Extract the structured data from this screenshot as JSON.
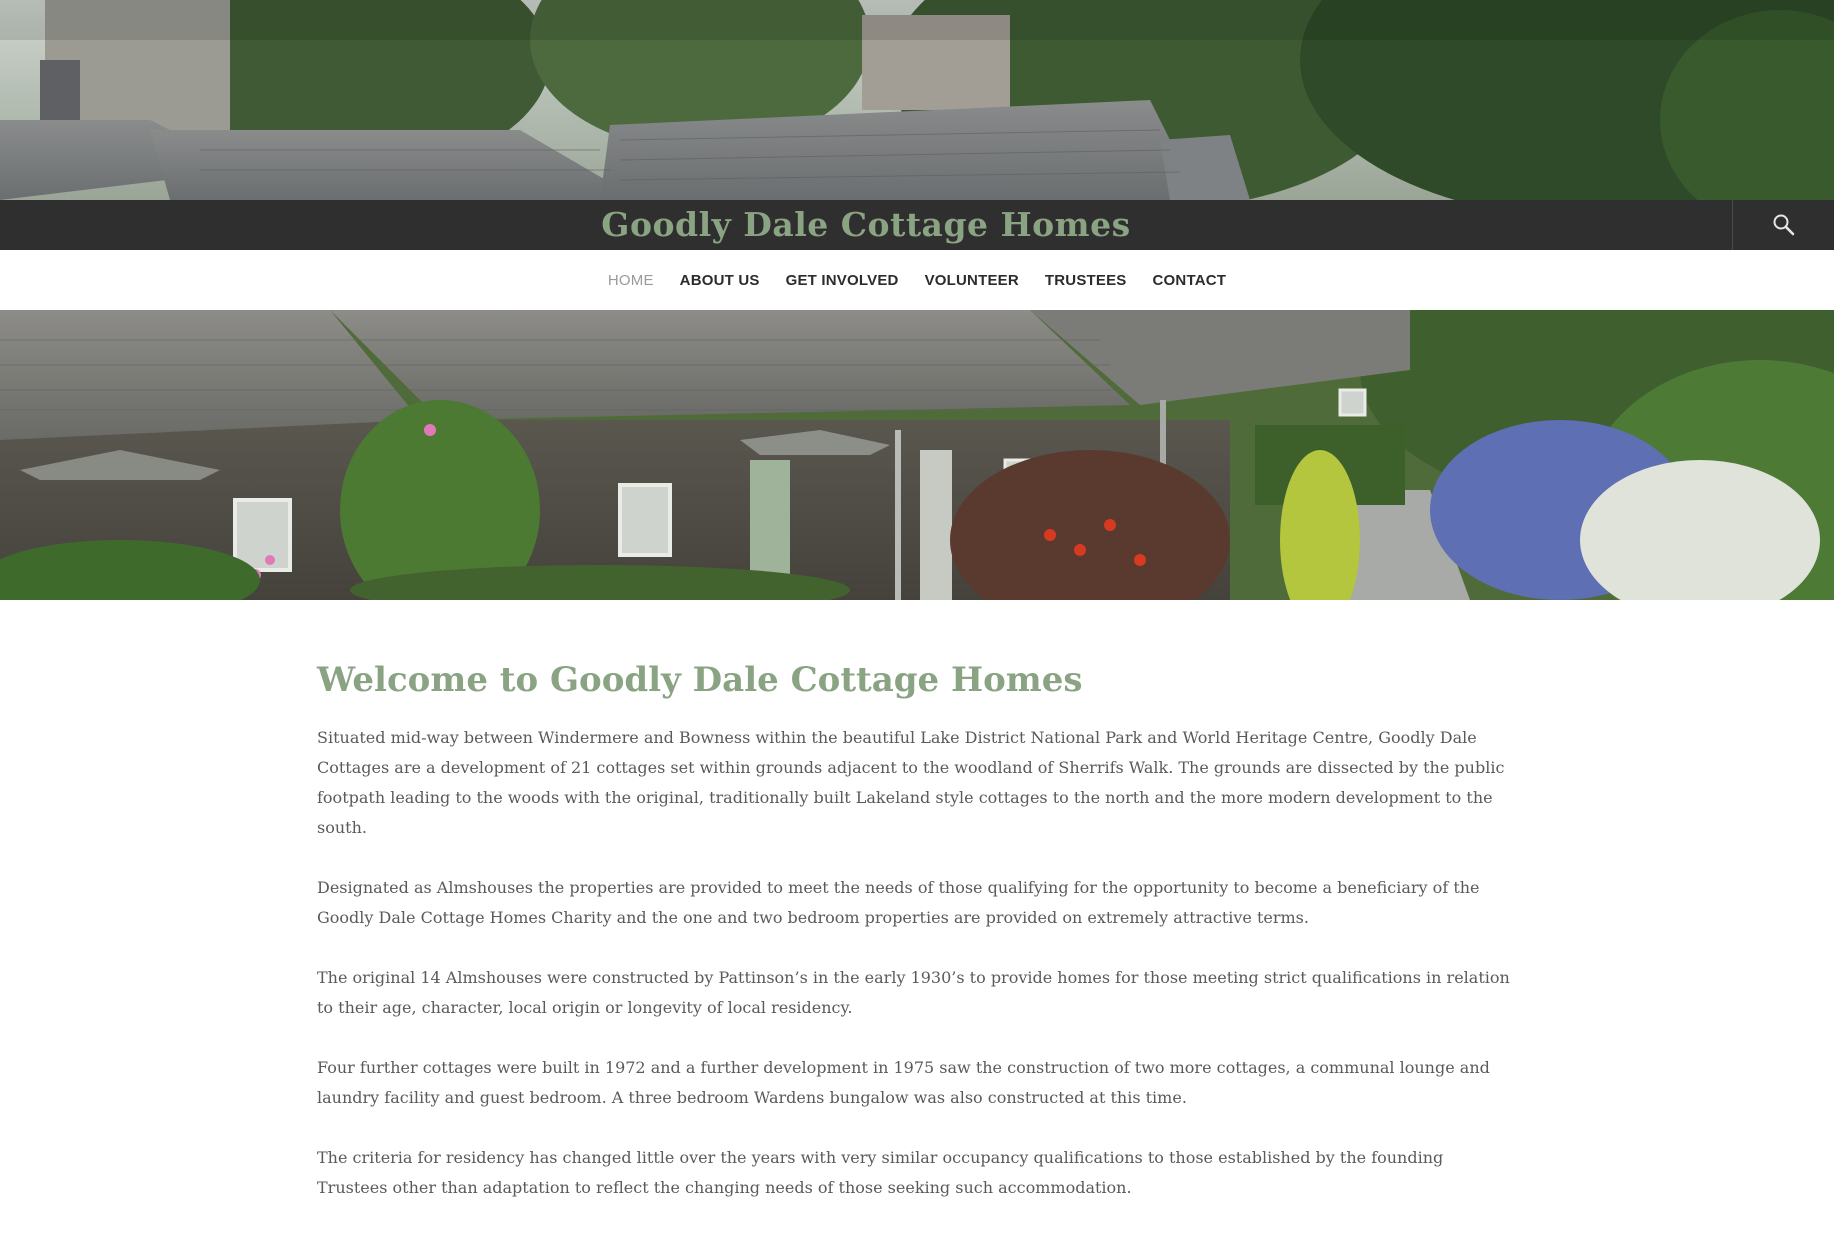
{
  "site": {
    "title": "Goodly Dale Cottage Homes"
  },
  "nav": {
    "items": [
      {
        "label": "HOME",
        "active": true
      },
      {
        "label": "ABOUT US",
        "active": false
      },
      {
        "label": "GET INVOLVED",
        "active": false
      },
      {
        "label": "VOLUNTEER",
        "active": false
      },
      {
        "label": "TRUSTEES",
        "active": false
      },
      {
        "label": "CONTACT",
        "active": false
      }
    ]
  },
  "icons": {
    "search": "search-icon"
  },
  "colors": {
    "brand_green": "#8aa383",
    "title_bar": "#2f2f2f",
    "body_text": "#5a5a5a",
    "nav_active": "#9a9a9a"
  },
  "main": {
    "heading": "Welcome to Goodly Dale Cottage Homes",
    "paragraphs": [
      "Situated mid-way between Windermere and Bowness within the beautiful Lake District National Park and World Heritage Centre, Goodly Dale Cottages are a development of 21 cottages set within grounds adjacent to the woodland of Sherrifs Walk. The grounds are dissected by the public footpath leading to the woods with the original, traditionally built Lakeland style cottages to the north and the more modern development to the south.",
      "Designated as Almshouses the properties are provided to meet the needs of those qualifying for the opportunity to become a beneficiary of the Goodly Dale Cottage Homes Charity and the one and two bedroom properties are provided on extremely attractive terms.",
      "The original 14 Almshouses were constructed by Pattinson’s in the early 1930’s to provide homes for those meeting strict qualifications in relation to their age, character, local origin or longevity of local residency.",
      "Four further cottages were built in 1972 and a further development in 1975 saw the construction of two more cottages, a communal lounge and laundry facility and guest bedroom. A three bedroom Wardens bungalow was also constructed at this time.",
      "The criteria for residency has changed little over the years with very similar occupancy qualifications to those established by the founding Trustees other than adaptation to reflect the changing needs of those seeking such accommodation."
    ]
  }
}
